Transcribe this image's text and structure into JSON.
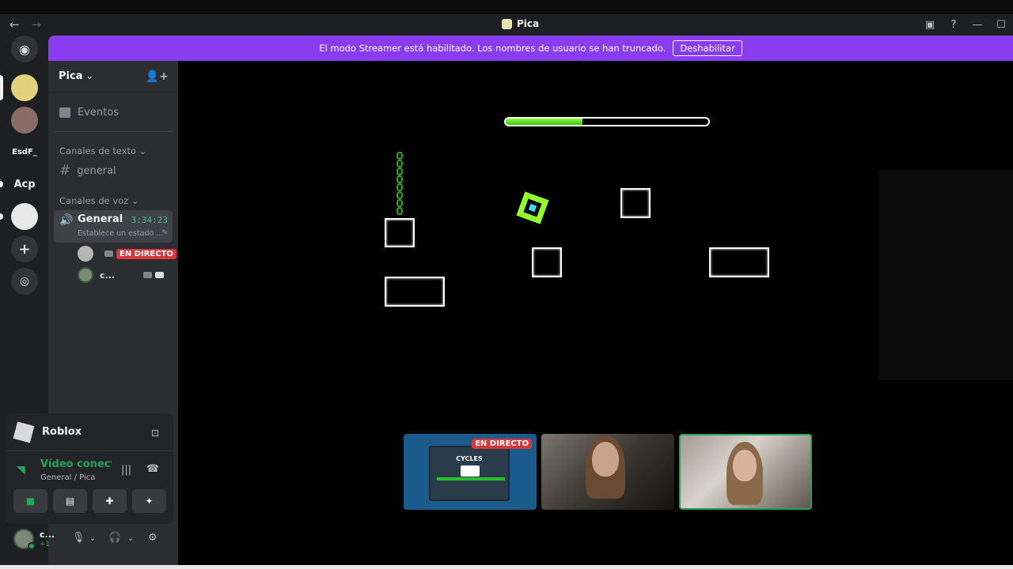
{
  "window": {
    "title": "Pica",
    "nav_back": "←",
    "nav_forward": "→",
    "icons": [
      "inbox-icon",
      "help-icon",
      "minimize-icon",
      "maximize-icon"
    ],
    "inbox_glyph": "▣",
    "help_glyph": "?",
    "minimize_glyph": "—",
    "maximize_glyph": "☐"
  },
  "banner": {
    "text": "El modo Streamer está habilitado. Los nombres de usuario se han truncado.",
    "button": "Deshabilitar",
    "color": "#8a3cf0"
  },
  "guilds": [
    {
      "label": "",
      "icon": "discord-home-icon"
    },
    {
      "label": "",
      "icon": "server-avatar-1"
    },
    {
      "label": "",
      "icon": "server-avatar-2"
    },
    {
      "label": "EsdF_",
      "icon": "text"
    },
    {
      "label": "Acp",
      "icon": "text"
    },
    {
      "label": "",
      "icon": "server-avatar-3"
    },
    {
      "label": "+",
      "icon": "add-server-icon"
    },
    {
      "label": "◎",
      "icon": "explore-icon"
    }
  ],
  "server": {
    "name": "Pica",
    "chevron": "⌄",
    "invite_glyph": "👤+",
    "events": "Eventos",
    "text_category": "Canales de texto",
    "text_channel": "general",
    "voice_category": "Canales de voz",
    "voice_channel": {
      "name": "General",
      "timer": "3:34:23",
      "status": "Establece un estado ...",
      "users": [
        {
          "name": "",
          "badge": "EN DIRECTO"
        },
        {
          "name": "c..."
        }
      ]
    }
  },
  "activity": {
    "name": "Roblox"
  },
  "connection": {
    "status": "Vídeo conectado",
    "location": "General / Pica"
  },
  "user": {
    "name": "c...",
    "sub": "+1"
  },
  "stage": {
    "progress_fraction": 0.38,
    "tiles": [
      {
        "label": "EN DIRECTO",
        "game_title": "CYCLES"
      },
      {
        "label": ""
      },
      {
        "label": ""
      }
    ]
  }
}
